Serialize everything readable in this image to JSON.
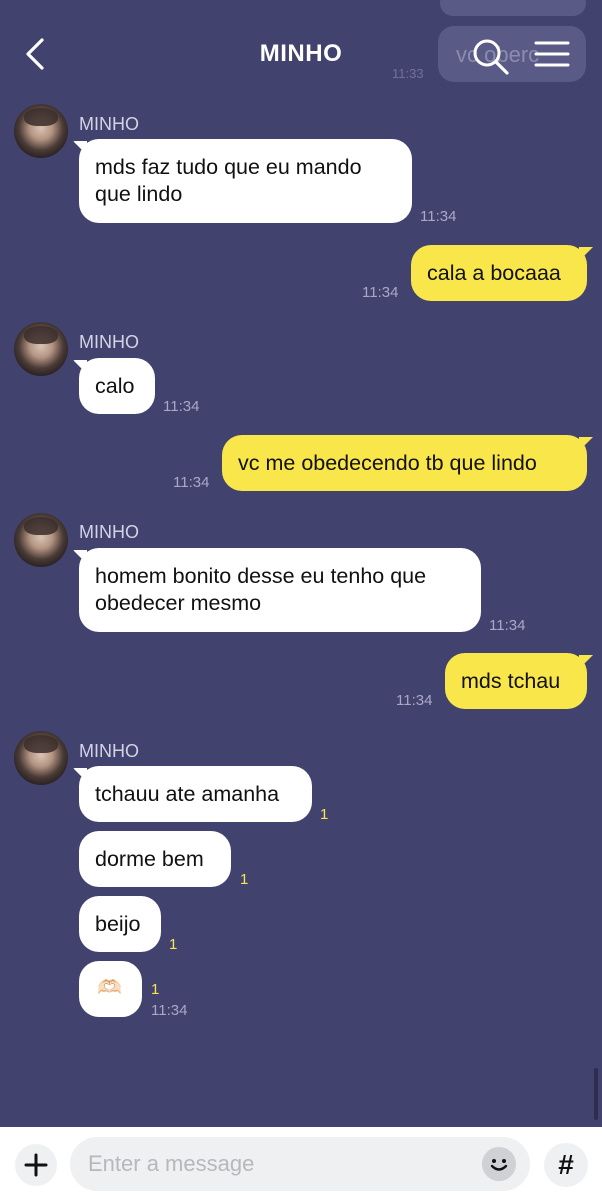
{
  "header": {
    "title": "MINHO"
  },
  "ghost": {
    "text": "vc oberc",
    "time": "11:33"
  },
  "messages": [
    {
      "sender": "MINHO",
      "lines": [
        "mds faz tudo que eu mando",
        "que lindo"
      ],
      "time": "11:34"
    },
    {
      "lines": [
        "cala a bocaaa"
      ],
      "time": "11:34"
    },
    {
      "sender": "MINHO",
      "lines": [
        "calo"
      ],
      "time": "11:34"
    },
    {
      "lines": [
        "vc me obedecendo tb que lindo"
      ],
      "time": "11:34"
    },
    {
      "sender": "MINHO",
      "lines": [
        "homem bonito desse eu tenho que",
        "obedecer mesmo"
      ],
      "time": "11:34"
    },
    {
      "lines": [
        "mds tchau"
      ],
      "time": "11:34"
    },
    {
      "sender": "MINHO",
      "text": "tchauu ate amanha",
      "unread": "1"
    },
    {
      "text": "dorme bem",
      "unread": "1"
    },
    {
      "text": "beijo",
      "unread": "1"
    },
    {
      "emoji": "🫶🏻",
      "unread": "1",
      "time": "11:34"
    }
  ],
  "input": {
    "placeholder": "Enter a message"
  },
  "icons": {
    "back": "chevron-left-icon",
    "search": "search-icon",
    "menu": "menu-icon",
    "plus": "plus-icon",
    "emoji": "emoji-icon",
    "hash": "hash-icon"
  },
  "colors": {
    "background": "#42426f",
    "incoming_bubble": "#ffffff",
    "outgoing_bubble": "#f9e64a",
    "unread_count": "#f9e64a"
  }
}
